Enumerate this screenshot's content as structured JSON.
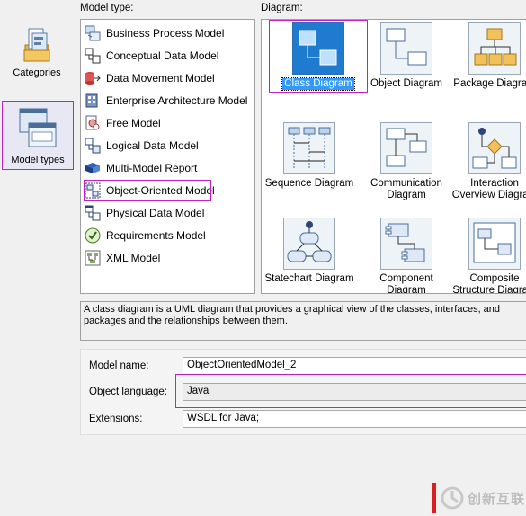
{
  "categories": {
    "items": [
      {
        "label": "Categories",
        "icon": "folder-files-icon"
      },
      {
        "label": "Model types",
        "icon": "model-windows-icon",
        "selected": true
      }
    ]
  },
  "model_type": {
    "header": "Model type:",
    "items": [
      {
        "label": "Business Process Model",
        "icon": "business-process-icon"
      },
      {
        "label": "Conceptual Data Model",
        "icon": "conceptual-data-icon"
      },
      {
        "label": "Data Movement Model",
        "icon": "data-movement-icon"
      },
      {
        "label": "Enterprise Architecture Model",
        "icon": "enterprise-architecture-icon"
      },
      {
        "label": "Free Model",
        "icon": "free-model-icon"
      },
      {
        "label": "Logical Data Model",
        "icon": "logical-data-icon"
      },
      {
        "label": "Multi-Model Report",
        "icon": "report-book-icon"
      },
      {
        "label": "Object-Oriented Model",
        "icon": "object-oriented-icon",
        "selected": true
      },
      {
        "label": "Physical Data Model",
        "icon": "physical-data-icon"
      },
      {
        "label": "Requirements Model",
        "icon": "requirements-icon"
      },
      {
        "label": "XML Model",
        "icon": "xml-model-icon"
      }
    ]
  },
  "diagram": {
    "header": "Diagram:",
    "items": [
      {
        "label": "Class Diagram",
        "icon": "class-diagram-icon",
        "selected": true
      },
      {
        "label": "Object Diagram",
        "icon": "object-diagram-icon"
      },
      {
        "label": "Package Diagram",
        "icon": "package-diagram-icon"
      },
      {
        "label": "Sequence Diagram",
        "icon": "sequence-diagram-icon"
      },
      {
        "label": "Communication Diagram",
        "icon": "communication-diagram-icon"
      },
      {
        "label": "Interaction Overview Diagram",
        "icon": "interaction-overview-icon"
      },
      {
        "label": "Statechart Diagram",
        "icon": "statechart-diagram-icon"
      },
      {
        "label": "Component Diagram",
        "icon": "component-diagram-icon"
      },
      {
        "label": "Composite Structure Diagram",
        "icon": "composite-structure-icon"
      }
    ]
  },
  "description": "A class diagram is a UML diagram that provides a graphical view of the classes, interfaces, and packages and the relationships between them.",
  "properties": {
    "model_name_label": "Model name:",
    "model_name_value": "ObjectOrientedModel_2",
    "object_language_label": "Object language:",
    "object_language_value": "Java",
    "extensions_label": "Extensions:",
    "extensions_value": "WSDL for Java;"
  },
  "watermark": {
    "text": "创新互联"
  },
  "colors": {
    "highlight": "#c022c0",
    "selection": "#3399ff"
  }
}
